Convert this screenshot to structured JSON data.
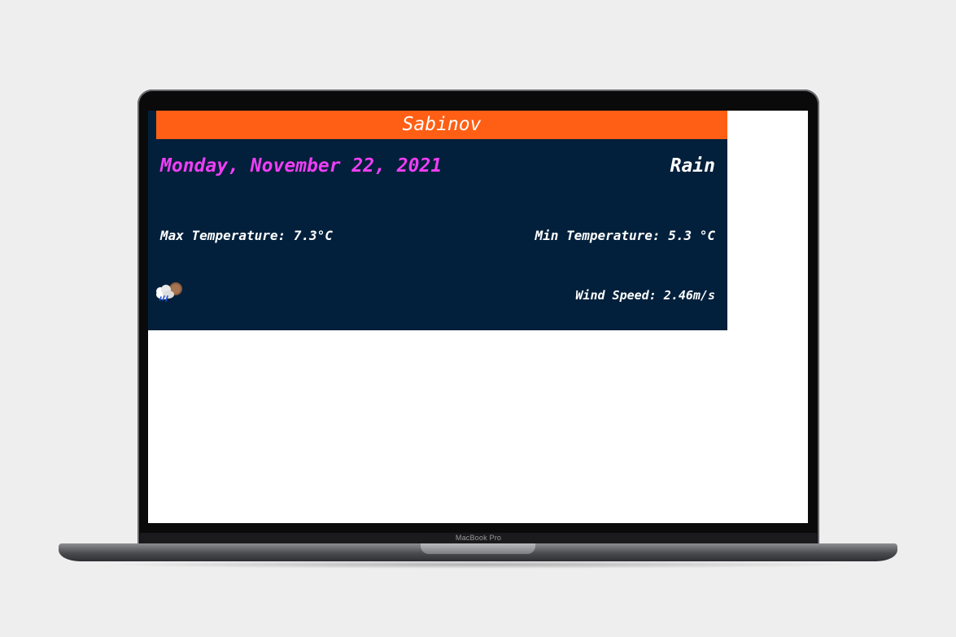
{
  "device": {
    "label": "MacBook Pro"
  },
  "weather": {
    "city": "Sabinov",
    "date": "Monday, November 22, 2021",
    "condition": "Rain",
    "max_temp": "Max Temperature: 7.3°C",
    "min_temp": "Min Temperature: 5.3 °C",
    "wind_speed": "Wind Speed: 2.46m/s",
    "icon": "rain-cloud-icon"
  },
  "colors": {
    "city_bar": "#ff5f14",
    "panel": "#02203b",
    "date_text": "#ef3ef5",
    "text": "#ffffff"
  }
}
